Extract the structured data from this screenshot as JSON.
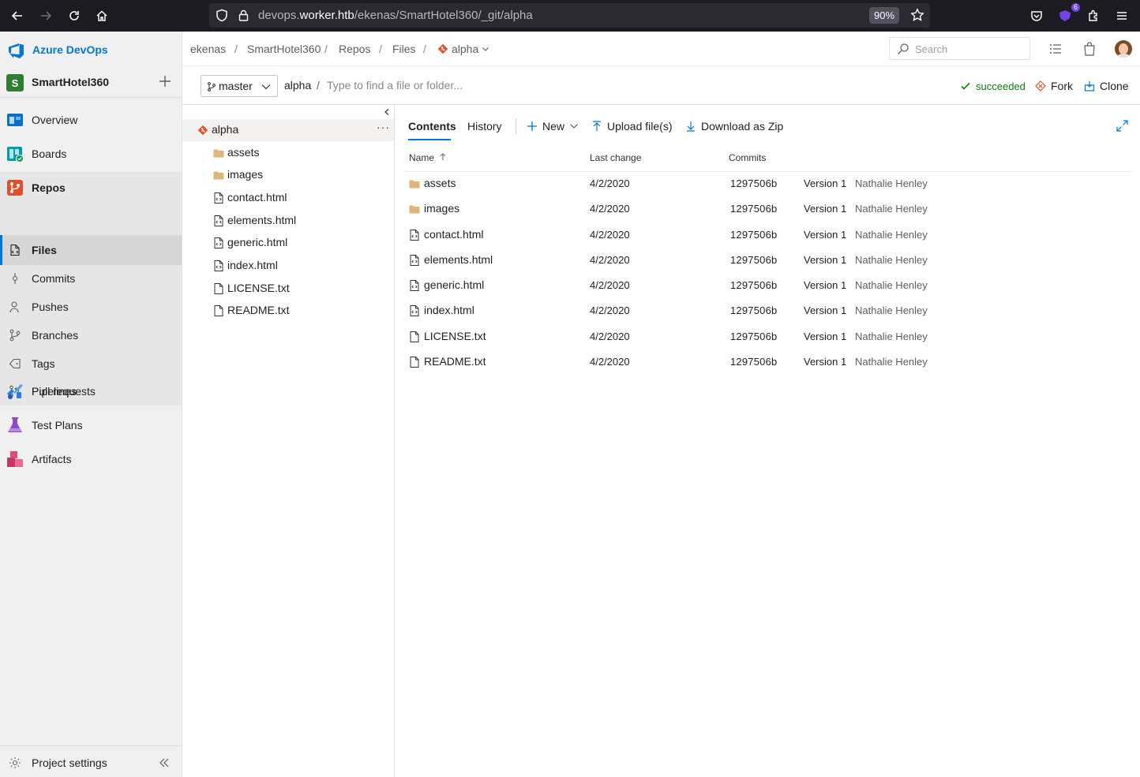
{
  "browser": {
    "url_prefix": "devops.",
    "url_host": "worker.htb",
    "url_path": "/ekenas/SmartHotel360/_git/alpha",
    "zoom": "90%",
    "extension_badge": "6"
  },
  "leftnav": {
    "brand": "Azure DevOps",
    "project": {
      "avatar_letter": "S",
      "name": "SmartHotel360"
    },
    "items": [
      {
        "label": "Overview"
      },
      {
        "label": "Boards"
      },
      {
        "label": "Repos"
      },
      {
        "label": "Files"
      },
      {
        "label": "Commits"
      },
      {
        "label": "Pushes"
      },
      {
        "label": "Branches"
      },
      {
        "label": "Tags"
      },
      {
        "label": "Pull requests"
      },
      {
        "label": "Pipelines"
      },
      {
        "label": "Test Plans"
      },
      {
        "label": "Artifacts"
      }
    ],
    "settings_label": "Project settings"
  },
  "header": {
    "breadcrumb": [
      "ekenas",
      "SmartHotel360",
      "Repos",
      "Files",
      "alpha"
    ],
    "search_placeholder": "Search"
  },
  "subheader": {
    "branch": "master",
    "repo": "alpha",
    "path_sep": "/",
    "path_placeholder": "Type to find a file or folder...",
    "status": "succeeded",
    "fork_label": "Fork",
    "clone_label": "Clone",
    "status_color": "#107c10"
  },
  "tree": {
    "root": "alpha",
    "items": [
      {
        "name": "assets",
        "type": "folder"
      },
      {
        "name": "images",
        "type": "folder"
      },
      {
        "name": "contact.html",
        "type": "code"
      },
      {
        "name": "elements.html",
        "type": "code"
      },
      {
        "name": "generic.html",
        "type": "code"
      },
      {
        "name": "index.html",
        "type": "code"
      },
      {
        "name": "LICENSE.txt",
        "type": "file"
      },
      {
        "name": "README.txt",
        "type": "file"
      }
    ]
  },
  "content": {
    "tabs": [
      "Contents",
      "History"
    ],
    "new_label": "New",
    "upload_label": "Upload file(s)",
    "download_label": "Download as Zip",
    "columns": {
      "name": "Name",
      "last_change": "Last change",
      "commits": "Commits"
    },
    "rows": [
      {
        "name": "assets",
        "type": "folder",
        "date": "4/2/2020",
        "commit": "1297506b",
        "message": "Version 1",
        "author": "Nathalie Henley"
      },
      {
        "name": "images",
        "type": "folder",
        "date": "4/2/2020",
        "commit": "1297506b",
        "message": "Version 1",
        "author": "Nathalie Henley"
      },
      {
        "name": "contact.html",
        "type": "code",
        "date": "4/2/2020",
        "commit": "1297506b",
        "message": "Version 1",
        "author": "Nathalie Henley"
      },
      {
        "name": "elements.html",
        "type": "code",
        "date": "4/2/2020",
        "commit": "1297506b",
        "message": "Version 1",
        "author": "Nathalie Henley"
      },
      {
        "name": "generic.html",
        "type": "code",
        "date": "4/2/2020",
        "commit": "1297506b",
        "message": "Version 1",
        "author": "Nathalie Henley"
      },
      {
        "name": "index.html",
        "type": "code",
        "date": "4/2/2020",
        "commit": "1297506b",
        "message": "Version 1",
        "author": "Nathalie Henley"
      },
      {
        "name": "LICENSE.txt",
        "type": "file",
        "date": "4/2/2020",
        "commit": "1297506b",
        "message": "Version 1",
        "author": "Nathalie Henley"
      },
      {
        "name": "README.txt",
        "type": "file",
        "date": "4/2/2020",
        "commit": "1297506b",
        "message": "Version 1",
        "author": "Nathalie Henley"
      }
    ]
  },
  "colors": {
    "accent": "#0078d4",
    "git": "#e0502d",
    "folder": "#dcb67a"
  }
}
